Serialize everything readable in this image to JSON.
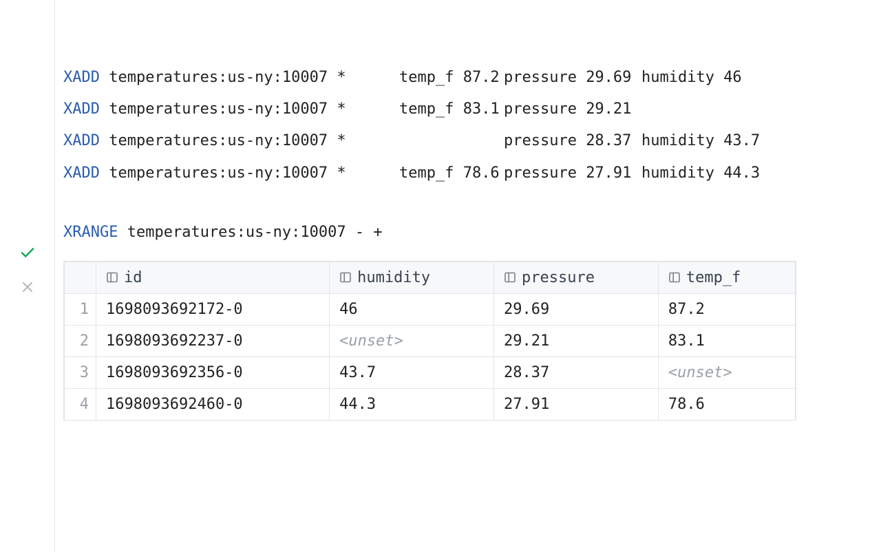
{
  "keywords": {
    "xadd": "XADD",
    "xrange": "XRANGE"
  },
  "stream_key": "temperatures:us-ny:10007",
  "star": "*",
  "field_labels": {
    "temp_f": "temp_f",
    "pressure": "pressure",
    "humidity": "humidity"
  },
  "xadd_lines": [
    {
      "temp_f": "87.2",
      "pressure": "29.69",
      "humidity": "46"
    },
    {
      "temp_f": "83.1",
      "pressure": "29.21",
      "humidity": null
    },
    {
      "temp_f": null,
      "pressure": "28.37",
      "humidity": "43.7"
    },
    {
      "temp_f": "78.6",
      "pressure": "27.91",
      "humidity": "44.3"
    }
  ],
  "xrange_tail": "- +",
  "unset_label": "<unset>",
  "table": {
    "columns": [
      "id",
      "humidity",
      "pressure",
      "temp_f"
    ],
    "rows": [
      {
        "n": "1",
        "id": "1698093692172-0",
        "humidity": "46",
        "pressure": "29.69",
        "temp_f": "87.2"
      },
      {
        "n": "2",
        "id": "1698093692237-0",
        "humidity": null,
        "pressure": "29.21",
        "temp_f": "83.1"
      },
      {
        "n": "3",
        "id": "1698093692356-0",
        "humidity": "43.7",
        "pressure": "28.37",
        "temp_f": null
      },
      {
        "n": "4",
        "id": "1698093692460-0",
        "humidity": "44.3",
        "pressure": "27.91",
        "temp_f": "78.6"
      }
    ]
  }
}
